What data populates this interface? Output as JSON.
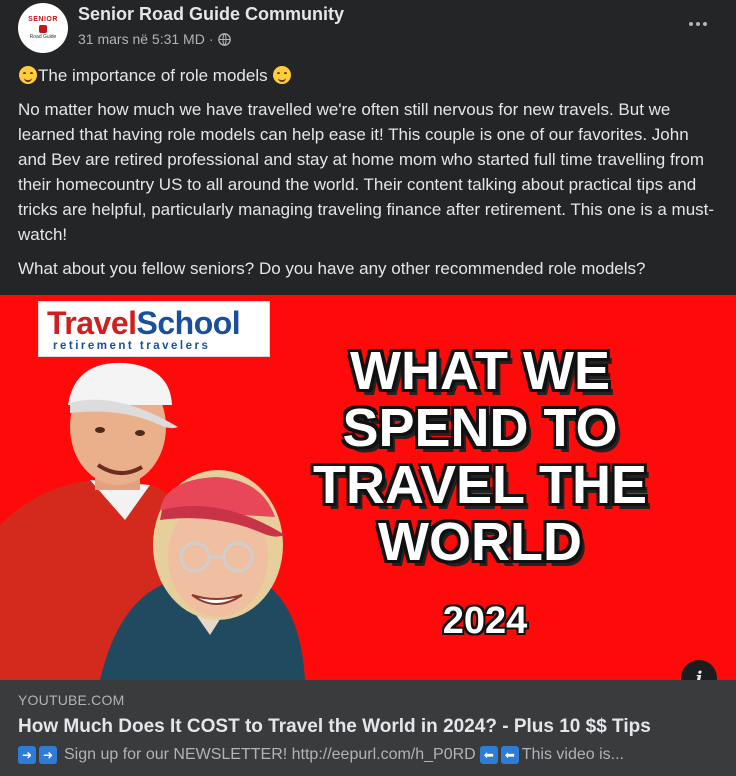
{
  "post": {
    "author": "Senior Road Guide Community",
    "avatar": {
      "line1": "SENIOR",
      "line2": "Road Guide"
    },
    "timestamp": "31 mars në 5:31 MD",
    "separator": "·",
    "privacy_icon": "globe-icon",
    "title": "The importance of role models",
    "body": "No matter how much we have travelled we're often still nervous for new travels. But we learned that having role models can help ease it! This couple is one of our favorites. John and Bev are retired professional and stay at home mom who started full time travelling from their homecountry US to all around the world. Their content talking about practical tips and tricks are helpful, particularly managing traveling finance after retirement. This one is a must-watch!",
    "question": "What about you fellow seniors? Do you have any other recommended role models?"
  },
  "thumbnail": {
    "logo_part1": "Travel",
    "logo_part2": "School",
    "logo_sub": "retirement travelers",
    "headline_lines": [
      "WHAT WE",
      "SPEND TO",
      "TRAVEL THE",
      "WORLD"
    ],
    "year": "2024",
    "info_label": "i"
  },
  "link_preview": {
    "domain": "YOUTUBE.COM",
    "title": "How Much Does It COST to Travel the World in 2024? - Plus 10 $$ Tips",
    "description": "Sign up for our NEWSLETTER! http://eepurl.com/h_P0RD",
    "description_tail": "This video is..."
  },
  "colors": {
    "background": "#242526",
    "footer": "#3a3b3c",
    "thumbnail_red": "#ff0a0a",
    "text": "#e4e6eb",
    "muted": "#b0b3b8"
  }
}
